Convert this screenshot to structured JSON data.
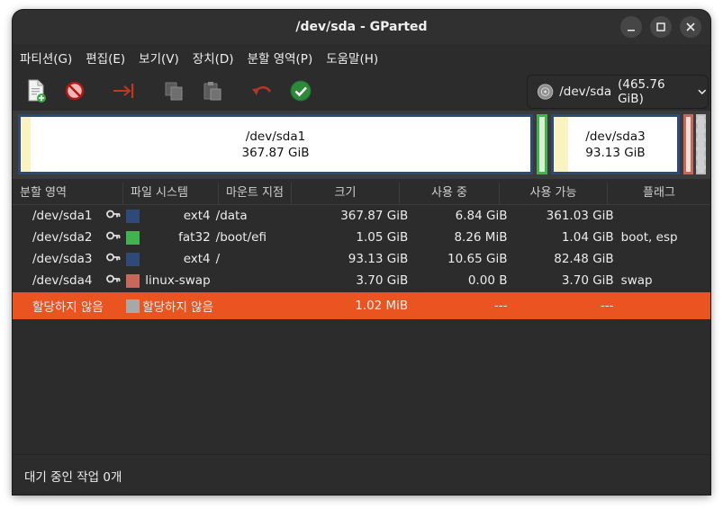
{
  "window": {
    "title": "/dev/sda - GParted"
  },
  "menu": [
    "파티션(G)",
    "편집(E)",
    "보기(V)",
    "장치(D)",
    "분할 영역(P)",
    "도움말(H)"
  ],
  "toolbar": {
    "icons": [
      "new-partition-icon",
      "delete-icon",
      "resize-move-icon",
      "copy-icon",
      "paste-icon",
      "undo-icon",
      "apply-icon"
    ]
  },
  "device": {
    "label": "/dev/sda",
    "size": "(465.76 GiB)"
  },
  "partition_map": {
    "sda1": {
      "name": "/dev/sda1",
      "size": "367.87 GiB",
      "used_fraction": 0.019
    },
    "sda3": {
      "name": "/dev/sda3",
      "size": "93.13 GiB",
      "used_fraction": 0.114
    }
  },
  "table": {
    "headers": [
      "분할 영역",
      "파일 시스템",
      "마운트 지점",
      "크기",
      "사용 중",
      "사용 가능",
      "플래그"
    ],
    "rows": [
      {
        "partition": "/dev/sda1",
        "color": "#2f4a78",
        "filesystem": "ext4",
        "mount": "/data",
        "size": "367.87 GiB",
        "used": "6.84 GiB",
        "unused": "361.03 GiB",
        "flags": ""
      },
      {
        "partition": "/dev/sda2",
        "color": "#3fb34f",
        "filesystem": "fat32",
        "mount": "/boot/efi",
        "size": "1.05 GiB",
        "used": "8.26 MiB",
        "unused": "1.04 GiB",
        "flags": "boot, esp"
      },
      {
        "partition": "/dev/sda3",
        "color": "#2f4a78",
        "filesystem": "ext4",
        "mount": "/",
        "size": "93.13 GiB",
        "used": "10.65 GiB",
        "unused": "82.48 GiB",
        "flags": ""
      },
      {
        "partition": "/dev/sda4",
        "color": "#c8685a",
        "filesystem": "linux-swap",
        "mount": "",
        "size": "3.70 GiB",
        "used": "0.00 B",
        "unused": "3.70 GiB",
        "flags": "swap"
      }
    ],
    "unallocated": {
      "partition": "할당하지 않음",
      "color": "#a8a8a8",
      "filesystem": "할당하지 않음",
      "size": "1.02 MiB",
      "used": "---",
      "unused": "---"
    }
  },
  "status": "대기 중인 작업 0개",
  "colors": {
    "accent": "#e95420",
    "ext4": "#2f4a78",
    "fat32": "#3fb34f",
    "swap": "#c8685a",
    "unallocated": "#a8a8a8",
    "used": "#f8f3c0"
  }
}
